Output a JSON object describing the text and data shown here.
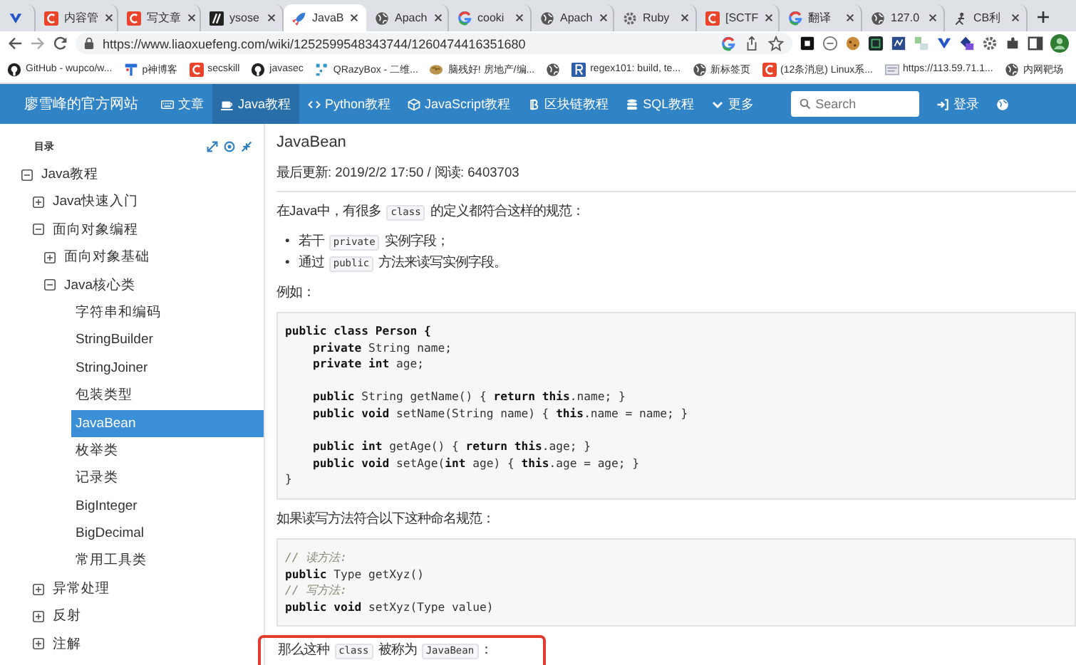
{
  "browser": {
    "tabs": [
      {
        "selected": false
      },
      {
        "title": "内容管",
        "selected": false
      },
      {
        "title": "写文章",
        "selected": false
      },
      {
        "title": "ysose",
        "selected": false
      },
      {
        "title": "JavaB",
        "selected": true
      },
      {
        "title": "Apach",
        "selected": false
      },
      {
        "title": "cooki",
        "selected": false
      },
      {
        "title": "Apach",
        "selected": false
      },
      {
        "title": "Ruby",
        "selected": false
      },
      {
        "title": "[SCTF",
        "selected": false
      },
      {
        "title": "翻译",
        "selected": false
      },
      {
        "title": "127.0",
        "selected": false
      },
      {
        "title": "CB利",
        "selected": false
      }
    ],
    "url": "https://www.liaoxuefeng.com/wiki/1252599548343744/1260474416351680",
    "bookmarks": [
      {
        "title": "GitHub - wupco/w..."
      },
      {
        "title": "p神博客"
      },
      {
        "title": "secskill"
      },
      {
        "title": "javasec"
      },
      {
        "title": "QRazyBox - 二维..."
      },
      {
        "title": "脑残好! 房地产/编..."
      },
      {
        "title": "regex101: build, te..."
      },
      {
        "title": "新标签页"
      },
      {
        "title": "(12条消息) Linux系..."
      },
      {
        "title": "https://113.59.71.1..."
      },
      {
        "title": "内网靶场"
      }
    ]
  },
  "site": {
    "title": "廖雪峰的官方网站",
    "nav": [
      {
        "label": "文章",
        "selected": false
      },
      {
        "label": "Java教程",
        "selected": true
      },
      {
        "label": "Python教程",
        "selected": false
      },
      {
        "label": "JavaScript教程",
        "selected": false
      },
      {
        "label": "区块链教程",
        "selected": false
      },
      {
        "label": "SQL教程",
        "selected": false
      },
      {
        "label": "更多",
        "selected": false
      }
    ],
    "search": {
      "placeholder": "Search"
    },
    "login": "登录"
  },
  "sidebar": {
    "heading": "目录",
    "tree": [
      {
        "label": "Java教程",
        "expanded": true,
        "selected": false,
        "children": [
          {
            "label": "Java快速入门",
            "expanded": false,
            "selected": false
          },
          {
            "label": "面向对象编程",
            "expanded": true,
            "selected": false,
            "children": [
              {
                "label": "面向对象基础",
                "expanded": false,
                "selected": false
              },
              {
                "label": "Java核心类",
                "expanded": true,
                "selected": false,
                "children": [
                  {
                    "label": "字符串和编码",
                    "selected": false
                  },
                  {
                    "label": "StringBuilder",
                    "selected": false
                  },
                  {
                    "label": "StringJoiner",
                    "selected": false
                  },
                  {
                    "label": "包装类型",
                    "selected": false
                  },
                  {
                    "label": "JavaBean",
                    "selected": true
                  },
                  {
                    "label": "枚举类",
                    "selected": false
                  },
                  {
                    "label": "记录类",
                    "selected": false
                  },
                  {
                    "label": "BigInteger",
                    "selected": false
                  },
                  {
                    "label": "BigDecimal",
                    "selected": false
                  },
                  {
                    "label": "常用工具类",
                    "selected": false
                  }
                ]
              }
            ]
          },
          {
            "label": "异常处理",
            "expanded": false,
            "selected": false
          },
          {
            "label": "反射",
            "expanded": false,
            "selected": false
          },
          {
            "label": "注解",
            "expanded": false,
            "selected": false
          }
        ]
      }
    ]
  },
  "article": {
    "title": "JavaBean",
    "meta": "最后更新: 2019/2/2 17:50 / 阅读: 6403703",
    "intro": [
      {
        "text": "在Java中，有很多 ",
        "kind": "text"
      },
      {
        "text": "class",
        "kind": "code"
      },
      {
        "text": " 的定义都符合这样的规范：",
        "kind": "text"
      }
    ],
    "bullets": [
      {
        "marker": "•",
        "segments": [
          {
            "text": "若干 ",
            "kind": "text"
          },
          {
            "text": "private",
            "kind": "code"
          },
          {
            "text": " 实例字段；",
            "kind": "text"
          }
        ]
      },
      {
        "marker": "•",
        "segments": [
          {
            "text": "通过 ",
            "kind": "text"
          },
          {
            "text": "public",
            "kind": "code"
          },
          {
            "text": " 方法来读写实例字段。",
            "kind": "text"
          }
        ]
      }
    ],
    "example_label": "例如：",
    "code1": [
      [
        {
          "text": "**public class Person {**",
          "kind": "code"
        },
        {
          "text": "    **private** String name;",
          "kind": "code"
        },
        {
          "text": "    **private int** age;",
          "kind": "code"
        }
      ],
      [
        {
          "text": "    **public** String getName() { **return this**.name; }",
          "kind": "code"
        },
        {
          "text": "    **public void** setName(String name) { **this**.name = name; }",
          "kind": "code"
        }
      ],
      [
        {
          "text": "    **public int** getAge() { **return this**.age; }",
          "kind": "code"
        },
        {
          "text": "    **public void** setAge(**int** age) { **this**.age = age; }",
          "kind": "code"
        },
        {
          "text": "}",
          "kind": "code"
        }
      ]
    ],
    "para2": "如果读写方法符合以下这种命名规范：",
    "code2": [
      [
        {
          "text": "// 读方法:",
          "kind": "comment"
        },
        {
          "text": "**public** Type getXyz()",
          "kind": "code"
        },
        {
          "text": "// 写方法:",
          "kind": "comment"
        },
        {
          "text": "**public void** setXyz(Type value)",
          "kind": "code"
        }
      ]
    ],
    "para3": {
      "highlighted": true,
      "segments": [
        {
          "text": "那么这种 ",
          "kind": "text"
        },
        {
          "text": "class",
          "kind": "code"
        },
        {
          "text": " 被称为 ",
          "kind": "text"
        },
        {
          "text": "JavaBean",
          "kind": "code"
        },
        {
          "text": "：",
          "kind": "text"
        }
      ]
    }
  }
}
